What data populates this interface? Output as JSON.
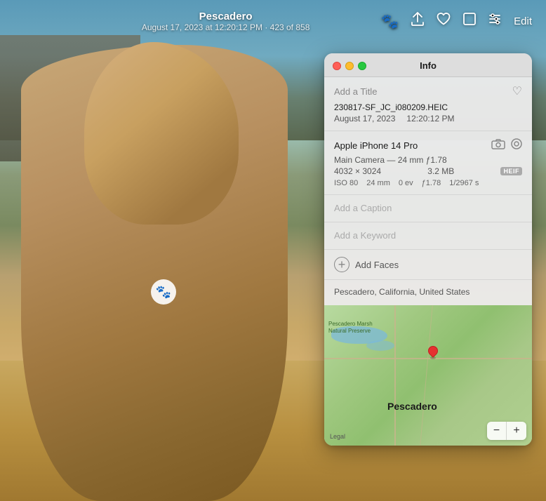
{
  "topbar": {
    "title": "Pescadero",
    "subtitle": "August 17, 2023 at 12:20:12 PM  ·  423 of 858",
    "edit_label": "Edit"
  },
  "info_panel": {
    "title": "Info",
    "add_title_placeholder": "Add a Title",
    "filename": "230817-SF_JC_i080209.HEIC",
    "date": "August 17, 2023",
    "time": "12:20:12 PM",
    "camera": {
      "name": "Apple iPhone 14 Pro",
      "lens": "Main Camera — 24 mm ƒ1.78",
      "resolution": "4032 × 3024",
      "filesize": "3.2 MB",
      "format": "HEIF",
      "iso": "ISO 80",
      "focal_length": "24 mm",
      "ev": "0 ev",
      "aperture": "ƒ1.78",
      "shutter": "1/2967 s"
    },
    "add_caption_placeholder": "Add a Caption",
    "add_keyword_placeholder": "Add a Keyword",
    "add_faces_label": "Add Faces",
    "location_name": "Pescadero, California, United States",
    "map": {
      "label_preserve": "Pescadero Marsh Natural Preserve",
      "label_city": "Pescadero",
      "legal": "Legal",
      "zoom_in": "+",
      "zoom_out": "−"
    }
  },
  "icons": {
    "paw": "🐾",
    "share": "↑",
    "heart": "♡",
    "heart_filled": "♥",
    "crop": "⊡",
    "adjust": "✦",
    "camera": "📷",
    "livephoto": "◎",
    "plus": "+",
    "minus": "−"
  }
}
